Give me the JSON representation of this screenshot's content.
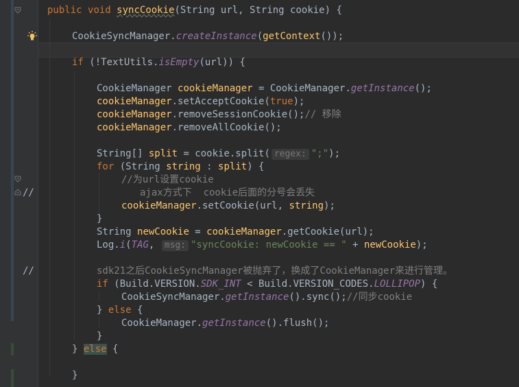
{
  "gutter": {
    "comment_marks": [
      "//",
      "//",
      "//"
    ]
  },
  "code": {
    "l1": [
      "public",
      "void",
      "syncCookie",
      "(String url, String cookie) {"
    ],
    "l2": [
      "CookieSyncManager.",
      "createInstance",
      "(",
      "getContext",
      "());"
    ],
    "l3": [
      "if",
      " (!TextUtils.",
      "isEmpty",
      "(url)) {"
    ],
    "l4": [
      "CookieManager ",
      "cookieManager",
      " = CookieManager.",
      "getInstance",
      "();"
    ],
    "l5": [
      "cookieManager",
      ".setAcceptCookie(",
      "true",
      ");"
    ],
    "l6": [
      "cookieManager",
      ".removeSessionCookie();",
      "// 移除"
    ],
    "l7": [
      "cookieManager",
      ".removeAllCookie();"
    ],
    "l8": [
      "String[] ",
      "split",
      " = cookie.split(",
      "regex:",
      "\";\"",
      ");"
    ],
    "l9": [
      "for",
      " (String ",
      "string",
      " : ",
      "split",
      ") {"
    ],
    "l10": [
      "//为url设置cookie"
    ],
    "l11": [
      "ajax方式下  cookie后面的分号会丢失"
    ],
    "l12": [
      "cookieManager",
      ".setCookie(url, ",
      "string",
      ");"
    ],
    "l13": [
      "}"
    ],
    "l14": [
      "String ",
      "newCookie",
      " = ",
      "cookieManager",
      ".getCookie(url);"
    ],
    "l15": [
      "Log.",
      "i",
      "(",
      "TAG",
      ", ",
      "msg:",
      "\"syncCookie: newCookie == \"",
      " + ",
      "newCookie",
      ");"
    ],
    "l16": [
      "sdk21之后CookieSyncManager被抛弃了，换成了CookieManager来进行管理。"
    ],
    "l17": [
      "if",
      " (Build.VERSION.",
      "SDK_INT",
      " < Build.VERSION_CODES.",
      "LOLLIPOP",
      ") {"
    ],
    "l18": [
      "CookieSyncManager.",
      "getInstance",
      "().sync();",
      "//同步cookie"
    ],
    "l19": [
      "} ",
      "else",
      " {"
    ],
    "l20": [
      "CookieManager.",
      "getInstance",
      "().flush();"
    ],
    "l21": [
      "}"
    ],
    "l22": [
      "} ",
      "else",
      " {"
    ],
    "l23": [
      "}"
    ]
  },
  "colors": {
    "background": "#2b2b2b",
    "keyword": "#cc7832",
    "method": "#ffc66d",
    "field": "#9876aa",
    "string": "#6a8759",
    "comment": "#808080",
    "text": "#a9b7c6"
  }
}
